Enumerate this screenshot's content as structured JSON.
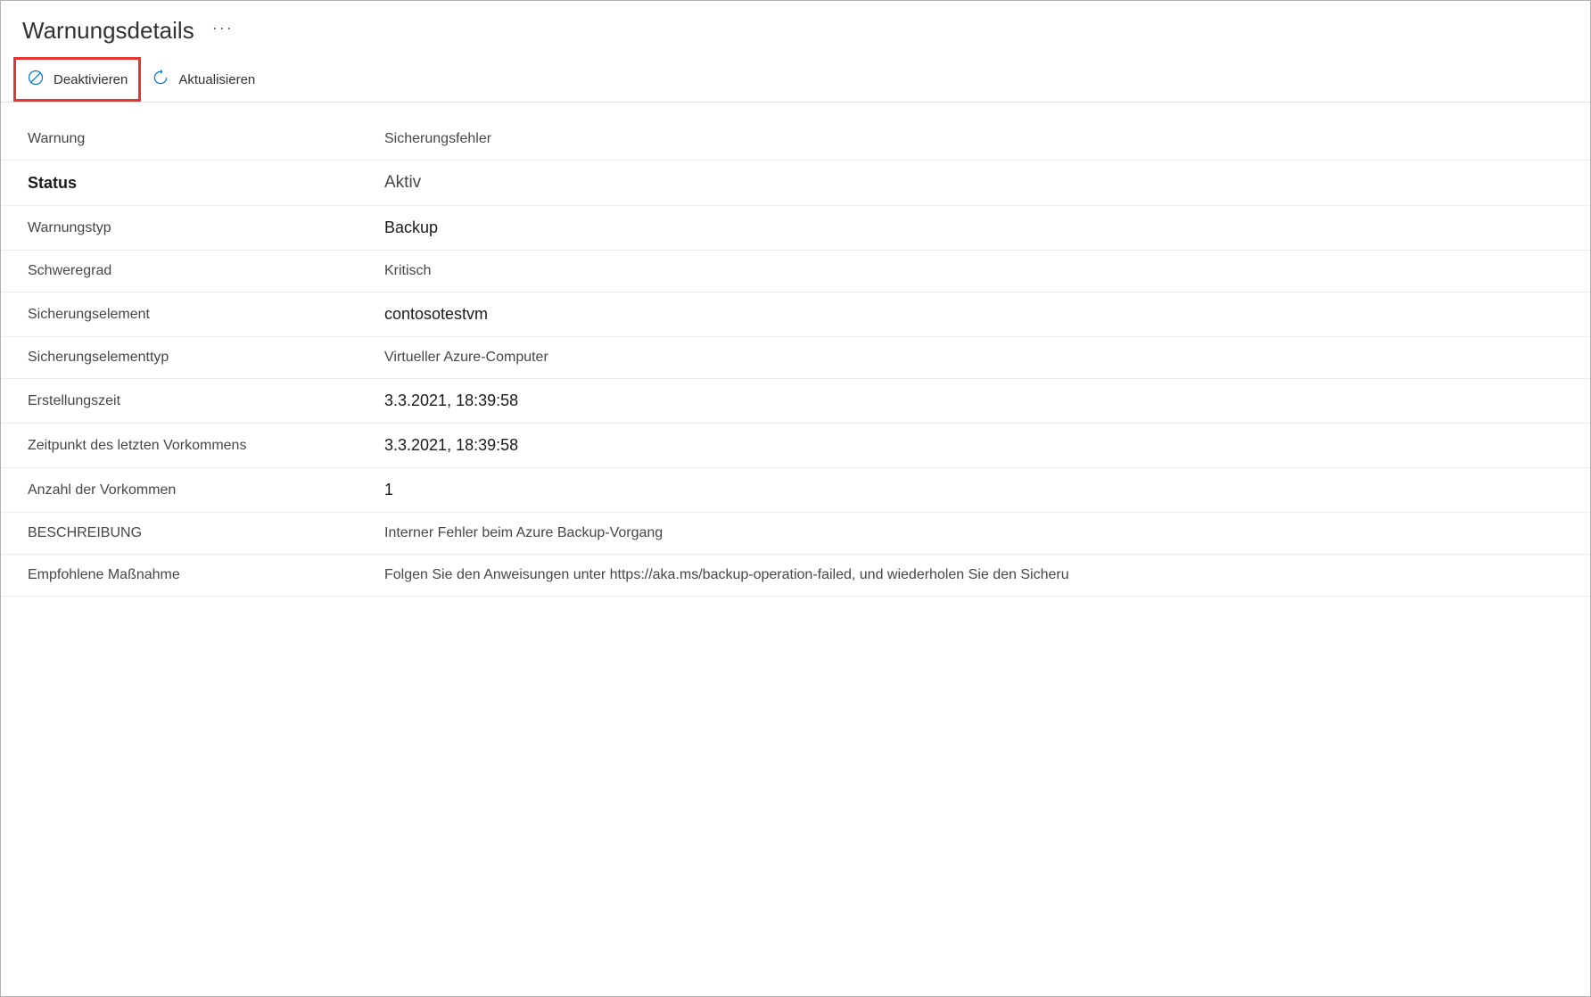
{
  "header": {
    "title": "Warnungsdetails",
    "more": "···"
  },
  "toolbar": {
    "deactivate_label": "Deaktivieren",
    "refresh_label": "Aktualisieren"
  },
  "details": {
    "rows": [
      {
        "label": "Warnung",
        "value": "Sicherungsfehler",
        "labelClass": "",
        "valueClass": ""
      },
      {
        "label": "Status",
        "value": "Aktiv",
        "labelClass": "bold",
        "valueClass": "status"
      },
      {
        "label": "Warnungstyp",
        "value": "Backup",
        "labelClass": "",
        "valueClass": "larger"
      },
      {
        "label": "Schweregrad",
        "value": "Kritisch",
        "labelClass": "",
        "valueClass": ""
      },
      {
        "label": "Sicherungselement",
        "value": "contosotestvm",
        "labelClass": "",
        "valueClass": "larger"
      },
      {
        "label": "Sicherungselementtyp",
        "value": "Virtueller Azure-Computer",
        "labelClass": "",
        "valueClass": ""
      },
      {
        "label": "Erstellungszeit",
        "value": "3.3.2021, 18:39:58",
        "labelClass": "",
        "valueClass": "larger"
      },
      {
        "label": "Zeitpunkt des letzten Vorkommens",
        "value": "3.3.2021, 18:39:58",
        "labelClass": "",
        "valueClass": "larger"
      },
      {
        "label": "Anzahl der Vorkommen",
        "value": "1",
        "labelClass": "",
        "valueClass": "larger"
      },
      {
        "label": "BESCHREIBUNG",
        "value": "Interner Fehler beim Azure Backup-Vorgang",
        "labelClass": "",
        "valueClass": ""
      },
      {
        "label": "Empfohlene Maßnahme",
        "value": "Folgen Sie den Anweisungen unter https://aka.ms/backup-operation-failed, und wiederholen Sie den Sicheru",
        "labelClass": "",
        "valueClass": ""
      }
    ]
  }
}
